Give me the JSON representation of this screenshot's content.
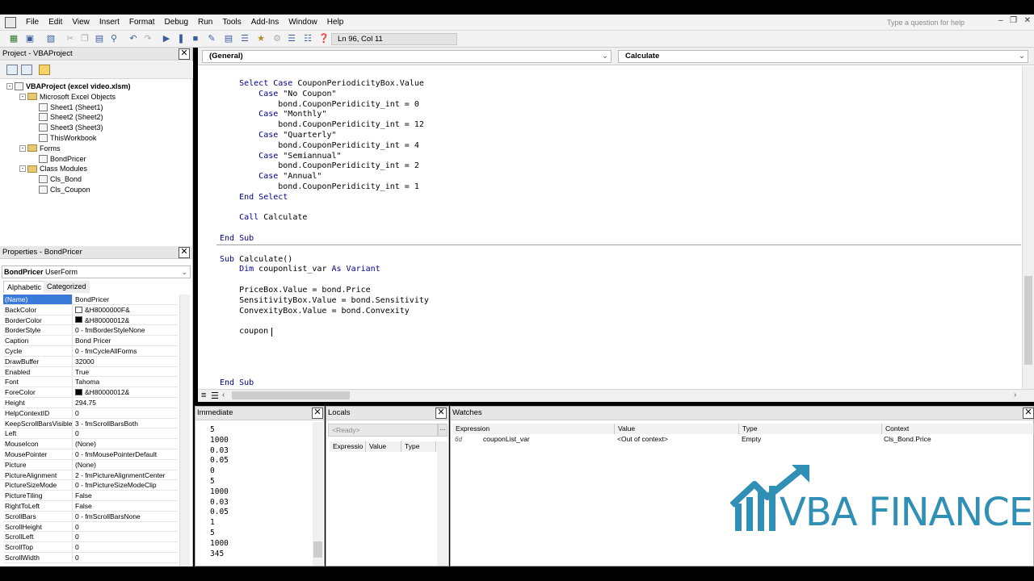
{
  "menubar": {
    "items": [
      "File",
      "Edit",
      "View",
      "Insert",
      "Format",
      "Debug",
      "Run",
      "Tools",
      "Add-Ins",
      "Window",
      "Help"
    ],
    "help_placeholder": "Type a question for help"
  },
  "toolbar": {
    "position": "Ln 96, Col 11"
  },
  "project": {
    "title": "Project - VBAProject",
    "tree": [
      {
        "label": "VBAProject (excel video.xlsm)",
        "kind": "root"
      },
      {
        "label": "Microsoft Excel Objects",
        "kind": "folder"
      },
      {
        "label": "Sheet1 (Sheet1)",
        "kind": "sheet"
      },
      {
        "label": "Sheet2 (Sheet2)",
        "kind": "sheet"
      },
      {
        "label": "Sheet3 (Sheet3)",
        "kind": "sheet"
      },
      {
        "label": "ThisWorkbook",
        "kind": "sheet"
      },
      {
        "label": "Forms",
        "kind": "folder"
      },
      {
        "label": "BondPricer",
        "kind": "form"
      },
      {
        "label": "Class Modules",
        "kind": "folder"
      },
      {
        "label": "Cls_Bond",
        "kind": "class"
      },
      {
        "label": "Cls_Coupon",
        "kind": "class"
      }
    ]
  },
  "properties": {
    "title": "Properties - BondPricer",
    "object_name": "BondPricer",
    "object_type": "UserForm",
    "tabs": [
      "Alphabetic",
      "Categorized"
    ],
    "rows": [
      {
        "name": "(Name)",
        "value": "BondPricer"
      },
      {
        "name": "BackColor",
        "value": "&H8000000F&",
        "swatch": "#ffffff"
      },
      {
        "name": "BorderColor",
        "value": "&H80000012&",
        "swatch": "#000000"
      },
      {
        "name": "BorderStyle",
        "value": "0 - fmBorderStyleNone"
      },
      {
        "name": "Caption",
        "value": "Bond Pricer"
      },
      {
        "name": "Cycle",
        "value": "0 - fmCycleAllForms"
      },
      {
        "name": "DrawBuffer",
        "value": "32000"
      },
      {
        "name": "Enabled",
        "value": "True"
      },
      {
        "name": "Font",
        "value": "Tahoma"
      },
      {
        "name": "ForeColor",
        "value": "&H80000012&",
        "swatch": "#000000"
      },
      {
        "name": "Height",
        "value": "294.75"
      },
      {
        "name": "HelpContextID",
        "value": "0"
      },
      {
        "name": "KeepScrollBarsVisible",
        "value": "3 - fmScrollBarsBoth"
      },
      {
        "name": "Left",
        "value": "0"
      },
      {
        "name": "MouseIcon",
        "value": "(None)"
      },
      {
        "name": "MousePointer",
        "value": "0 - fmMousePointerDefault"
      },
      {
        "name": "Picture",
        "value": "(None)"
      },
      {
        "name": "PictureAlignment",
        "value": "2 - fmPictureAlignmentCenter"
      },
      {
        "name": "PictureSizeMode",
        "value": "0 - fmPictureSizeModeClip"
      },
      {
        "name": "PictureTiling",
        "value": "False"
      },
      {
        "name": "RightToLeft",
        "value": "False"
      },
      {
        "name": "ScrollBars",
        "value": "0 - fmScrollBarsNone"
      },
      {
        "name": "ScrollHeight",
        "value": "0"
      },
      {
        "name": "ScrollLeft",
        "value": "0"
      },
      {
        "name": "ScrollTop",
        "value": "0"
      },
      {
        "name": "ScrollWidth",
        "value": "0"
      }
    ]
  },
  "code": {
    "object_combo": "(General)",
    "proc_combo": "Calculate",
    "lines": [
      {
        "text": "    Select Case CouponPeriodicityBox.Value",
        "kw": true
      },
      {
        "text": "        Case \"No Coupon\"",
        "kw": true
      },
      {
        "text": "            bond.CouponPeridicity_int = 0",
        "kw": false
      },
      {
        "text": "        Case \"Monthly\"",
        "kw": true
      },
      {
        "text": "            bond.CouponPeridicity_int = 12",
        "kw": false
      },
      {
        "text": "        Case \"Quarterly\"",
        "kw": true
      },
      {
        "text": "            bond.CouponPeridicity_int = 4",
        "kw": false
      },
      {
        "text": "        Case \"Semiannual\"",
        "kw": true
      },
      {
        "text": "            bond.CouponPeridicity_int = 2",
        "kw": false
      },
      {
        "text": "        Case \"Annual\"",
        "kw": true
      },
      {
        "text": "            bond.CouponPeridicity_int = 1",
        "kw": false
      },
      {
        "text": "    End Select",
        "kw": true
      },
      {
        "text": "",
        "kw": false
      },
      {
        "text": "    Call Calculate",
        "kw": true
      },
      {
        "text": "",
        "kw": false
      },
      {
        "text": "End Sub",
        "kw": true
      },
      {
        "text": "",
        "kw": false
      },
      {
        "text": "Sub Calculate()",
        "kw": true
      },
      {
        "text": "    Dim couponlist_var As Variant",
        "kw": true
      },
      {
        "text": "",
        "kw": false
      },
      {
        "text": "    PriceBox.Value = bond.Price",
        "kw": false
      },
      {
        "text": "    SensitivityBox.Value = bond.Sensitivity",
        "kw": false
      },
      {
        "text": "    ConvexityBox.Value = bond.Convexity",
        "kw": false
      },
      {
        "text": "",
        "kw": false
      },
      {
        "text": "    coupon",
        "kw": false
      },
      {
        "text": "",
        "kw": false
      },
      {
        "text": "",
        "kw": false
      },
      {
        "text": "",
        "kw": false
      },
      {
        "text": "",
        "kw": false
      },
      {
        "text": "End Sub",
        "kw": true
      }
    ]
  },
  "immediate": {
    "title": "Immediate",
    "lines": [
      "5",
      "1000",
      "0.03",
      "0.05",
      "0",
      "5",
      "1000",
      "0.03",
      "0.05",
      "1",
      "5",
      "1000",
      "345"
    ]
  },
  "locals": {
    "title": "Locals",
    "status": "<Ready>",
    "columns": [
      "Expressio",
      "Value",
      "Type"
    ]
  },
  "watches": {
    "title": "Watches",
    "columns": [
      "Expression",
      "Value",
      "Type",
      "Context"
    ],
    "rows": [
      {
        "expression": "couponList_var",
        "value": "<Out of context>",
        "type": "Empty",
        "context": "Cls_Bond.Price"
      }
    ]
  },
  "logo": {
    "text": "VBA FINANCE",
    "color": "#2f8fb5"
  },
  "colors": {
    "keyword": "#00008b",
    "selection": "#3a79d8"
  }
}
